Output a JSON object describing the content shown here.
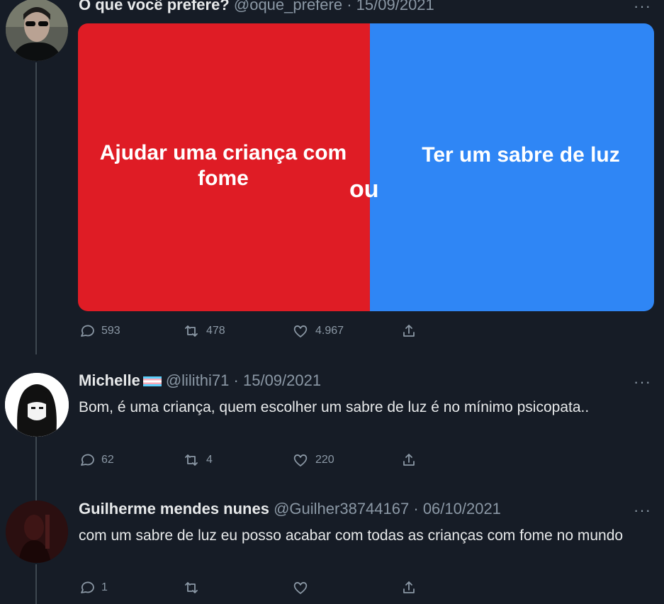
{
  "tweets": [
    {
      "name": "O que você prefere?",
      "handle": "@oque_prefere",
      "date": "15/09/2021",
      "image": {
        "left_option": "Ajudar uma criança com fome",
        "separator": "ou",
        "right_option": "Ter um sabre de luz",
        "left_color": "#df1c25",
        "right_color": "#2f86f5"
      },
      "actions": {
        "replies": "593",
        "retweets": "478",
        "likes": "4.967"
      }
    },
    {
      "name": "Michelle",
      "handle": "@lilithi71",
      "date": "15/09/2021",
      "text": "Bom, é uma criança, quem escolher um sabre de luz é no mínimo psicopata..",
      "actions": {
        "replies": "62",
        "retweets": "4",
        "likes": "220"
      }
    },
    {
      "name": "Guilherme mendes nunes",
      "handle": "@Guilher38744167",
      "date": "06/10/2021",
      "text": "com um sabre de luz eu posso acabar com todas as crianças com fome no mundo",
      "actions": {
        "replies": "1",
        "retweets": "",
        "likes": ""
      }
    }
  ],
  "separator_dot": "·",
  "more_glyph": "···",
  "icons": [
    "reply-icon",
    "retweet-icon",
    "like-icon",
    "share-icon",
    "more-icon",
    "trans-flag-icon"
  ]
}
